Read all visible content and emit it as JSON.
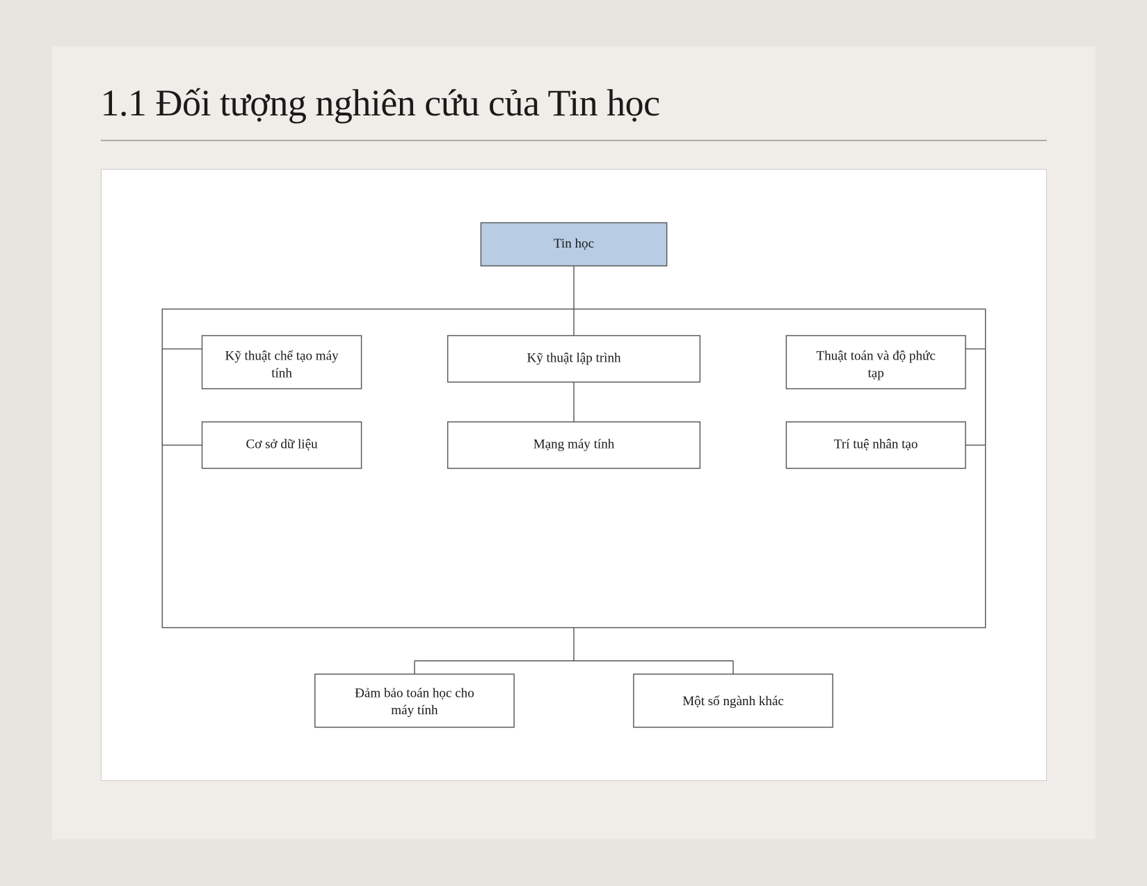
{
  "slide": {
    "title": "1.1 Đối tượng nghiên cứu của Tin học"
  },
  "diagram": {
    "root_label": "Tin học",
    "nodes": [
      {
        "id": "ky_thuat_che_tao",
        "label": "Kỹ thuật chế tạo máy\ntính",
        "col": "left",
        "row": 1
      },
      {
        "id": "ky_thuat_lap_trinh",
        "label": "Kỹ thuật lập trình",
        "col": "center",
        "row": 1
      },
      {
        "id": "thuat_toan",
        "label": "Thuật toán và độ phức\ntạp",
        "col": "right",
        "row": 1
      },
      {
        "id": "co_so_du_lieu",
        "label": "Cơ sở dữ liệu",
        "col": "left",
        "row": 2
      },
      {
        "id": "mang_may_tinh",
        "label": "Mạng máy tính",
        "col": "center",
        "row": 2
      },
      {
        "id": "tri_tue_nhan_tao",
        "label": "Trí tuệ nhân tạo",
        "col": "right",
        "row": 2
      },
      {
        "id": "dam_bao_toan_hoc",
        "label": "Đảm bảo toán học cho\nmáy tính",
        "col": "center-left",
        "row": 3
      },
      {
        "id": "mot_so_nganh",
        "label": "Một số ngành khác",
        "col": "center-right",
        "row": 3
      }
    ]
  }
}
